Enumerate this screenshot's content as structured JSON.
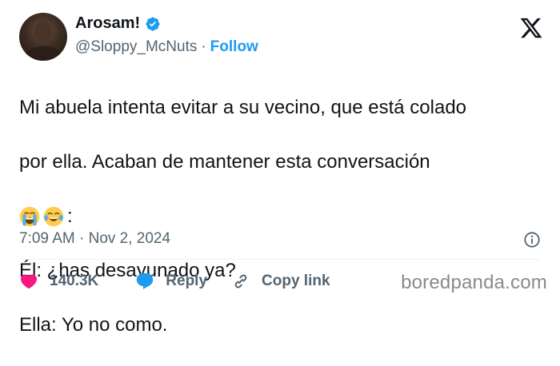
{
  "author": {
    "display_name": "Arosam!",
    "handle": "@Sloppy_McNuts",
    "separator": "·",
    "follow_label": "Follow",
    "verified": true,
    "verified_color": "#1d9bf0"
  },
  "platform_icon": "x-logo-icon",
  "tweet": {
    "line1": "Mi abuela intenta evitar a su vecino, que está colado",
    "line2": "por ella. Acaban de mantener esta conversación",
    "emojis": [
      "loudly-crying-face-emoji",
      "tears-of-joy-emoji"
    ],
    "emoji_suffix": ":",
    "line4": "Él: ¿has desayunado ya?",
    "line5": "Ella: Yo no como."
  },
  "timestamp": {
    "time": "7:09 AM",
    "separator": "·",
    "date": "Nov 2, 2024"
  },
  "actions": {
    "likes": "140.3K",
    "reply_label": "Reply",
    "copy_link_label": "Copy link"
  },
  "colors": {
    "like_heart": "#f91880",
    "reply_bubble": "#1d9bf0",
    "link_blue": "#1d9bf0",
    "muted_text": "#536471"
  },
  "watermark": "boredpanda.com"
}
